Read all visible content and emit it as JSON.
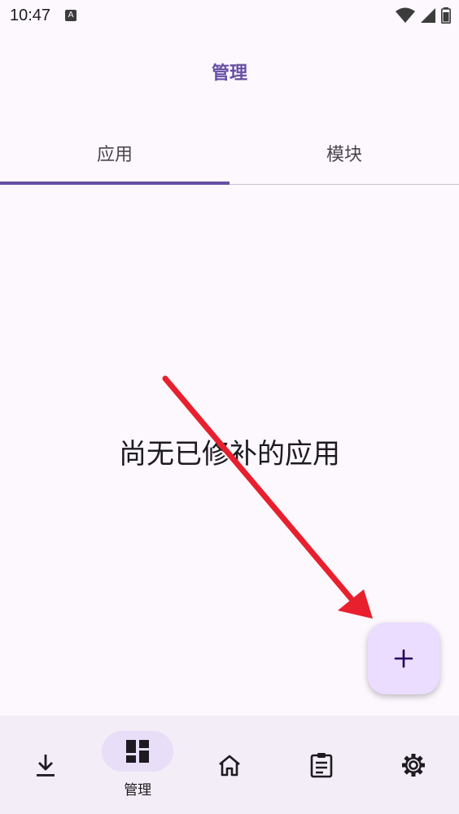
{
  "status_bar": {
    "time": "10:47",
    "notification_icon_letter": "A",
    "icons": [
      "wifi-icon",
      "signal-icon",
      "battery-icon"
    ]
  },
  "header": {
    "title": "管理"
  },
  "tabs": [
    {
      "label": "应用",
      "active": true
    },
    {
      "label": "模块",
      "active": false
    }
  ],
  "main": {
    "empty_message": "尚无已修补的应用"
  },
  "fab": {
    "icon": "add-icon"
  },
  "bottom_nav": {
    "items": [
      {
        "name": "download",
        "icon": "download-icon",
        "label": ""
      },
      {
        "name": "manage",
        "icon": "dashboard-icon",
        "label": "管理",
        "active": true
      },
      {
        "name": "home",
        "icon": "home-icon",
        "label": ""
      },
      {
        "name": "logs",
        "icon": "clipboard-icon",
        "label": ""
      },
      {
        "name": "settings",
        "icon": "gear-icon",
        "label": ""
      }
    ]
  },
  "colors": {
    "accent": "#6750a4",
    "background": "#fdf7fe",
    "nav_background": "#f3edf7",
    "fab_background": "#eaddff",
    "annotation_arrow": "#e8202e"
  }
}
